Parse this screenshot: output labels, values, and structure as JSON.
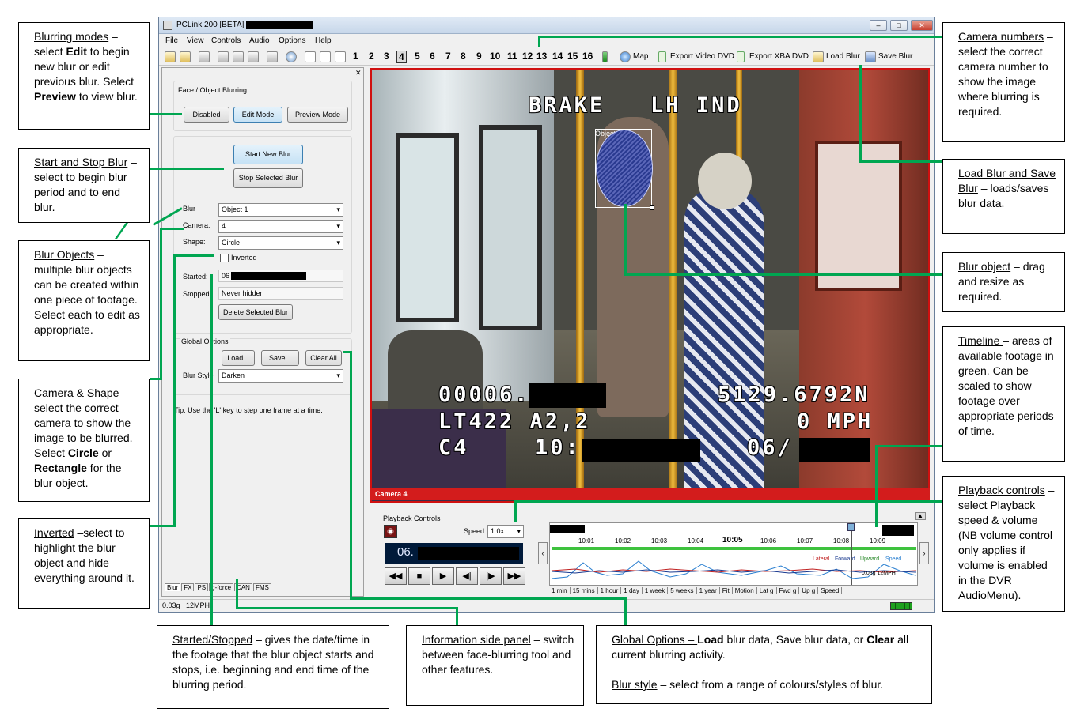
{
  "app": {
    "title": "PCLink 200 [BETA]",
    "menu": [
      "File",
      "View",
      "Controls",
      "Audio",
      "Options",
      "Help"
    ],
    "camera_numbers": [
      "1",
      "2",
      "3",
      "4",
      "5",
      "6",
      "7",
      "8",
      "9",
      "10",
      "11",
      "12",
      "13",
      "14",
      "15",
      "16"
    ],
    "selected_camera": "4",
    "toolbar": {
      "map": "Map",
      "export_video": "Export Video DVD",
      "export_xba": "Export XBA DVD",
      "load_blur": "Load Blur",
      "save_blur": "Save Blur"
    },
    "panel": {
      "group_title": "Face / Object Blurring",
      "mode_buttons": [
        "Disabled",
        "Edit Mode",
        "Preview Mode"
      ],
      "start_blur": "Start New Blur",
      "stop_blur": "Stop Selected Blur",
      "blur_label": "Blur",
      "blur_value": "Object 1",
      "camera_label": "Camera:",
      "camera_value": "4",
      "shape_label": "Shape:",
      "shape_value": "Circle",
      "inverted_label": "Inverted",
      "started_label": "Started:",
      "started_value": "06",
      "stopped_label": "Stopped:",
      "stopped_value": "Never hidden",
      "delete_blur": "Delete Selected Blur",
      "global_title": "Global Options",
      "load": "Load...",
      "save": "Save...",
      "clear_all": "Clear All",
      "blur_style_label": "Blur Style",
      "blur_style_value": "Darken",
      "tip": "Tip: Use the 'L' key to step one frame at a time.",
      "tabs": [
        "Blur",
        "FX",
        "PS",
        "g-force",
        "CAN",
        "FMS"
      ]
    },
    "video": {
      "osd_top": "BRAKE   LH IND",
      "object_label": "Object 1",
      "osd_line1_left": "00006.",
      "osd_line1_right": "5129.6792N",
      "osd_line2_left": "LT422 A2,2",
      "osd_line2_right": "0 MPH",
      "osd_line3_left": "C4",
      "osd_line3_mid": "10:",
      "osd_line3_right": "06/",
      "camera_label": "Camera 4"
    },
    "playback": {
      "title": "Playback Controls",
      "speed_label": "Speed:",
      "speed_value": "1.0x",
      "time_display": "06.",
      "ticks": [
        "10:01",
        "10:02",
        "10:03",
        "10:04",
        "10:05",
        "10:06",
        "10:07",
        "10:08",
        "10:09"
      ],
      "legend": [
        "Lateral",
        "Forward",
        "Upward",
        "Speed"
      ],
      "readout": "0.03g  12MPH",
      "scales": [
        "1 min",
        "15 mins",
        "1 hour",
        "1 day",
        "1 week",
        "5 weeks",
        "1 year",
        "Fit",
        "Motion",
        "Lat g",
        "Fwd g",
        "Up g",
        "Speed"
      ]
    },
    "status": {
      "text": "0.03g   12MPH"
    }
  },
  "callouts": {
    "blurring_modes": {
      "title": "Blurring modes",
      "body_a": " – select ",
      "edit": "Edit",
      "body_b": " to begin new blur or edit previous blur. Select ",
      "preview": "Preview",
      "body_c": " to view blur."
    },
    "start_stop": {
      "title": "Start and Stop Blur",
      "body": " – select to begin blur period and to end blur."
    },
    "blur_objects": {
      "title": "Blur Objects",
      "body": " – multiple blur objects can be created within one piece of footage. Select each to edit as appropriate."
    },
    "camera_shape": {
      "title": "Camera & Shape",
      "body_a": " – select the correct camera to show the image to be blurred.   Select ",
      "circle": "Circle",
      "or": " or ",
      "rectangle": "Rectangle",
      "body_b": " for the blur object."
    },
    "inverted": {
      "title": "Inverted",
      "body": " –select to highlight the blur object and hide everything around it."
    },
    "started_stopped": {
      "title": "Started/Stopped",
      "body": " – gives the date/time in the footage that the blur object starts and stops, i.e. beginning and end time of the blurring period."
    },
    "info_panel": {
      "title": "Information side panel",
      "body": " – switch between face-blurring tool and other features."
    },
    "global_options": {
      "title": "Global Options – ",
      "load": "Load",
      "body_a": " blur data, S",
      "save": "ave",
      "body_b": " blur data, or ",
      "clear": "Clear",
      "body_c": " all current blurring activity.",
      "style_title": "Blur style",
      "style_body": " – select from a range of colours/styles of blur."
    },
    "camera_numbers": {
      "title": "Camera numbers",
      "body": " – select the correct camera number to show the image where blurring is required."
    },
    "load_save": {
      "title": "Load Blur and Save Blur",
      "body": " – loads/saves blur data."
    },
    "blur_object": {
      "title": "Blur object",
      "body": " – drag and resize as required."
    },
    "timeline": {
      "title": "Timeline ",
      "body": "– areas of available footage in green. Can be scaled to show footage over appropriate periods of time."
    },
    "playback_controls": {
      "title": "Playback controls",
      "body": " – select Playback speed & volume (NB volume control only applies if volume is enabled in the DVR AudioMenu)."
    }
  }
}
